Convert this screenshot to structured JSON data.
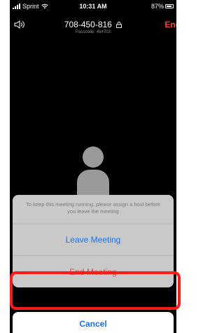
{
  "status_bar": {
    "carrier": "Sprint",
    "time": "10:31 AM",
    "battery": "87%"
  },
  "meeting": {
    "meeting_id": "708-450-816",
    "passcode": "Passcode: 464703",
    "end_label": "End"
  },
  "action_sheet": {
    "message": "To keep this meeting running, please assign a host before you leave the meeting",
    "leave_label": "Leave Meeting",
    "end_label": "End Meeting",
    "cancel_label": "Cancel"
  },
  "colors": {
    "action_blue": "#1a73e8",
    "destructive_red": "#ff3b30",
    "highlight_red": "#ff1a1a"
  }
}
